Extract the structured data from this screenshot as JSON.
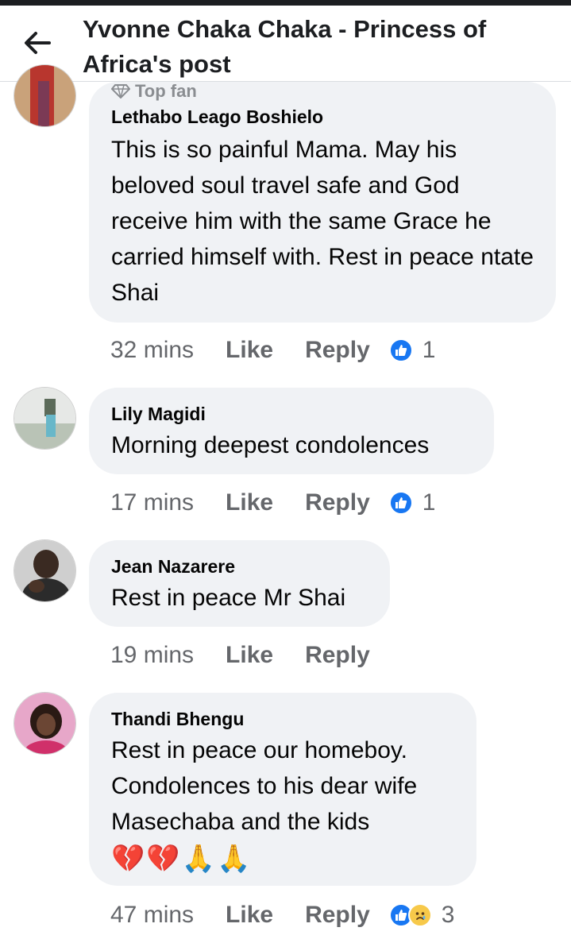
{
  "header": {
    "title": "Yvonne Chaka Chaka - Princess of Africa's post"
  },
  "comments": [
    {
      "badge": "Top fan",
      "author": "Lethabo Leago Boshielo",
      "text": "This is so painful Mama. May his beloved soul travel safe and God receive him with the same Grace he carried himself with. Rest in peace ntate Shai",
      "time": "32 mins",
      "like": "Like",
      "reply": "Reply",
      "reaction_count": "1"
    },
    {
      "author": "Lily Magidi",
      "text": "Morning deepest condolences",
      "time": "17 mins",
      "like": "Like",
      "reply": "Reply",
      "reaction_count": "1"
    },
    {
      "author": "Jean Nazarere",
      "text": "Rest in peace Mr Shai",
      "time": "19 mins",
      "like": "Like",
      "reply": "Reply"
    },
    {
      "author": "Thandi Bhengu",
      "text": "Rest in peace our homeboy. Condolences to his dear wife Masechaba and the kids",
      "emojis": [
        "💔",
        "💔",
        "🙏",
        "🙏"
      ],
      "time": "47 mins",
      "like": "Like",
      "reply": "Reply",
      "reaction_count": "3"
    }
  ],
  "colors": {
    "accent": "#1877f2",
    "bubble": "#f0f2f5",
    "meta": "#65676b"
  }
}
